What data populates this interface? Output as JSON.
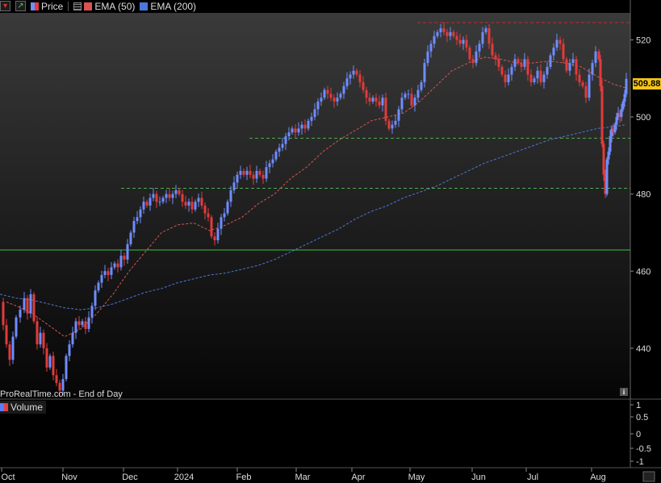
{
  "legend": {
    "price_label": "Price",
    "ema50_label": "EMA (50)",
    "ema200_label": "EMA (200)"
  },
  "colors": {
    "up": "#6f8dff",
    "down": "#e23b3b",
    "ema50": "#d9534f",
    "ema200": "#4a78d8",
    "support_line": "#3fbf3f",
    "resistance_line": "#c82828",
    "dashed_support": "#4caf50",
    "price_tag": "#f5c518"
  },
  "watermark": "ProRealTime.com - End of Day",
  "last_price_label": "509.88",
  "volume_panel": {
    "label": "Volume",
    "axis_ticks": [
      "1",
      "0.5",
      "0",
      "-0.5",
      "-1"
    ]
  },
  "chart_data": {
    "type": "candlestick",
    "y_ticks": [
      440,
      460,
      480,
      500,
      520
    ],
    "ylim": [
      427,
      527
    ],
    "x_labels": [
      "Oct",
      "Nov",
      "Dec",
      "2024",
      "Feb",
      "Mar",
      "Apr",
      "May",
      "Jun",
      "Jul",
      "Aug"
    ],
    "last_price": 509.88,
    "horizontal_lines": [
      {
        "kind": "resistance",
        "value": 524.5,
        "style": "dashed"
      },
      {
        "kind": "support",
        "value": 494.5,
        "style": "dashed"
      },
      {
        "kind": "support",
        "value": 481.5,
        "style": "dashed"
      },
      {
        "kind": "support",
        "value": 465.5,
        "style": "solid"
      }
    ],
    "price_path": [
      [
        0,
        452
      ],
      [
        4,
        446
      ],
      [
        8,
        441
      ],
      [
        12,
        437
      ],
      [
        16,
        443
      ],
      [
        20,
        448
      ],
      [
        25,
        450
      ],
      [
        30,
        453
      ],
      [
        34,
        449
      ],
      [
        38,
        454
      ],
      [
        42,
        447
      ],
      [
        46,
        441
      ],
      [
        50,
        444
      ],
      [
        54,
        440
      ],
      [
        58,
        435
      ],
      [
        62,
        438
      ],
      [
        66,
        433
      ],
      [
        70,
        431
      ],
      [
        74,
        429
      ],
      [
        78,
        432
      ],
      [
        82,
        438
      ],
      [
        86,
        441
      ],
      [
        90,
        444
      ],
      [
        94,
        447
      ],
      [
        98,
        446
      ],
      [
        102,
        447
      ],
      [
        106,
        445
      ],
      [
        110,
        448
      ],
      [
        114,
        451
      ],
      [
        118,
        455
      ],
      [
        122,
        457
      ],
      [
        126,
        459
      ],
      [
        130,
        460
      ],
      [
        134,
        459
      ],
      [
        138,
        461
      ],
      [
        142,
        462
      ],
      [
        146,
        461
      ],
      [
        150,
        464
      ],
      [
        154,
        463
      ],
      [
        158,
        467
      ],
      [
        162,
        470
      ],
      [
        166,
        473
      ],
      [
        170,
        474
      ],
      [
        174,
        476
      ],
      [
        178,
        478
      ],
      [
        182,
        477
      ],
      [
        186,
        479
      ],
      [
        190,
        480
      ],
      [
        194,
        478
      ],
      [
        198,
        478
      ],
      [
        202,
        479
      ],
      [
        206,
        480
      ],
      [
        210,
        479
      ],
      [
        214,
        480
      ],
      [
        218,
        481
      ],
      [
        222,
        480
      ],
      [
        226,
        478
      ],
      [
        230,
        477
      ],
      [
        234,
        478
      ],
      [
        238,
        476
      ],
      [
        242,
        478
      ],
      [
        246,
        479
      ],
      [
        250,
        477
      ],
      [
        254,
        475
      ],
      [
        258,
        474
      ],
      [
        262,
        469
      ],
      [
        266,
        468
      ],
      [
        270,
        471
      ],
      [
        274,
        474
      ],
      [
        278,
        475
      ],
      [
        282,
        478
      ],
      [
        286,
        481
      ],
      [
        290,
        483
      ],
      [
        294,
        485
      ],
      [
        298,
        486
      ],
      [
        302,
        485
      ],
      [
        306,
        486
      ],
      [
        310,
        485
      ],
      [
        314,
        484
      ],
      [
        318,
        486
      ],
      [
        322,
        485
      ],
      [
        326,
        484
      ],
      [
        330,
        487
      ],
      [
        334,
        488
      ],
      [
        338,
        489
      ],
      [
        342,
        491
      ],
      [
        346,
        492
      ],
      [
        350,
        493
      ],
      [
        354,
        495
      ],
      [
        358,
        496
      ],
      [
        362,
        497
      ],
      [
        366,
        496
      ],
      [
        370,
        497
      ],
      [
        374,
        498
      ],
      [
        378,
        497
      ],
      [
        382,
        499
      ],
      [
        386,
        500
      ],
      [
        390,
        502
      ],
      [
        394,
        504
      ],
      [
        398,
        505
      ],
      [
        402,
        507
      ],
      [
        406,
        506
      ],
      [
        410,
        505
      ],
      [
        414,
        504
      ],
      [
        418,
        505
      ],
      [
        422,
        506
      ],
      [
        426,
        508
      ],
      [
        430,
        510
      ],
      [
        434,
        511
      ],
      [
        438,
        512
      ],
      [
        442,
        511
      ],
      [
        446,
        509
      ],
      [
        450,
        507
      ],
      [
        454,
        505
      ],
      [
        458,
        504
      ],
      [
        462,
        505
      ],
      [
        466,
        504
      ],
      [
        470,
        503
      ],
      [
        474,
        505
      ],
      [
        478,
        499
      ],
      [
        482,
        497
      ],
      [
        486,
        498
      ],
      [
        490,
        499
      ],
      [
        494,
        502
      ],
      [
        498,
        505
      ],
      [
        502,
        506
      ],
      [
        506,
        506
      ],
      [
        510,
        503
      ],
      [
        514,
        505
      ],
      [
        518,
        507
      ],
      [
        522,
        509
      ],
      [
        526,
        514
      ],
      [
        530,
        517
      ],
      [
        534,
        519
      ],
      [
        538,
        521
      ],
      [
        542,
        522
      ],
      [
        546,
        523
      ],
      [
        550,
        522
      ],
      [
        554,
        521
      ],
      [
        558,
        522
      ],
      [
        562,
        521
      ],
      [
        566,
        520
      ],
      [
        570,
        519
      ],
      [
        574,
        520
      ],
      [
        578,
        518
      ],
      [
        582,
        515
      ],
      [
        586,
        514
      ],
      [
        590,
        517
      ],
      [
        594,
        519
      ],
      [
        598,
        522
      ],
      [
        602,
        523
      ],
      [
        606,
        519
      ],
      [
        610,
        516
      ],
      [
        614,
        515
      ],
      [
        618,
        513
      ],
      [
        622,
        511
      ],
      [
        626,
        509
      ],
      [
        630,
        511
      ],
      [
        634,
        513
      ],
      [
        638,
        515
      ],
      [
        642,
        514
      ],
      [
        646,
        513
      ],
      [
        650,
        515
      ],
      [
        654,
        511
      ],
      [
        658,
        509
      ],
      [
        662,
        510
      ],
      [
        666,
        512
      ],
      [
        670,
        509
      ],
      [
        674,
        511
      ],
      [
        678,
        513
      ],
      [
        682,
        516
      ],
      [
        686,
        518
      ],
      [
        690,
        520
      ],
      [
        694,
        519
      ],
      [
        698,
        515
      ],
      [
        702,
        512
      ],
      [
        706,
        514
      ],
      [
        710,
        515
      ],
      [
        714,
        511
      ],
      [
        718,
        509
      ],
      [
        722,
        508
      ],
      [
        726,
        505
      ],
      [
        730,
        511
      ],
      [
        734,
        514
      ],
      [
        738,
        517
      ],
      [
        742,
        515
      ],
      [
        744,
        508
      ],
      [
        746,
        493
      ],
      [
        748,
        485
      ],
      [
        750,
        480
      ],
      [
        752,
        489
      ],
      [
        754,
        491
      ],
      [
        756,
        495
      ],
      [
        758,
        497
      ],
      [
        760,
        496
      ],
      [
        762,
        498
      ],
      [
        764,
        500
      ],
      [
        766,
        501
      ],
      [
        768,
        500
      ],
      [
        770,
        502
      ],
      [
        772,
        504
      ],
      [
        774,
        506
      ],
      [
        776,
        509.88
      ]
    ],
    "ema50_path": [
      [
        8,
        452
      ],
      [
        20,
        451
      ],
      [
        40,
        449
      ],
      [
        60,
        446
      ],
      [
        80,
        443
      ],
      [
        100,
        445
      ],
      [
        120,
        449
      ],
      [
        140,
        454
      ],
      [
        160,
        460
      ],
      [
        180,
        465
      ],
      [
        200,
        470
      ],
      [
        220,
        472
      ],
      [
        240,
        472.5
      ],
      [
        260,
        470.5
      ],
      [
        280,
        472
      ],
      [
        300,
        474
      ],
      [
        320,
        477.5
      ],
      [
        340,
        480
      ],
      [
        360,
        484
      ],
      [
        380,
        487
      ],
      [
        400,
        491
      ],
      [
        420,
        494
      ],
      [
        440,
        496.5
      ],
      [
        460,
        499
      ],
      [
        480,
        500
      ],
      [
        500,
        501
      ],
      [
        520,
        504
      ],
      [
        540,
        508
      ],
      [
        560,
        512
      ],
      [
        580,
        514
      ],
      [
        600,
        515.5
      ],
      [
        620,
        515
      ],
      [
        640,
        514
      ],
      [
        660,
        514
      ],
      [
        680,
        514.5
      ],
      [
        700,
        514
      ],
      [
        720,
        513
      ],
      [
        740,
        510.5
      ],
      [
        760,
        508.5
      ],
      [
        776,
        507.5
      ]
    ],
    "ema200_path": [
      [
        0,
        454
      ],
      [
        20,
        453
      ],
      [
        40,
        452.5
      ],
      [
        60,
        451.5
      ],
      [
        80,
        450.5
      ],
      [
        100,
        450
      ],
      [
        120,
        450.5
      ],
      [
        140,
        451.5
      ],
      [
        160,
        453
      ],
      [
        180,
        454.5
      ],
      [
        200,
        455.5
      ],
      [
        220,
        457
      ],
      [
        240,
        458
      ],
      [
        260,
        459
      ],
      [
        280,
        459.5
      ],
      [
        300,
        460.5
      ],
      [
        320,
        461.5
      ],
      [
        340,
        463
      ],
      [
        360,
        465
      ],
      [
        380,
        467
      ],
      [
        400,
        469
      ],
      [
        420,
        471
      ],
      [
        440,
        473.5
      ],
      [
        460,
        475.5
      ],
      [
        480,
        477
      ],
      [
        500,
        479
      ],
      [
        520,
        480.5
      ],
      [
        540,
        482
      ],
      [
        560,
        484
      ],
      [
        580,
        486
      ],
      [
        600,
        488
      ],
      [
        620,
        489.5
      ],
      [
        640,
        491
      ],
      [
        660,
        492.5
      ],
      [
        680,
        494
      ],
      [
        700,
        495
      ],
      [
        720,
        496
      ],
      [
        740,
        497
      ],
      [
        760,
        497.5
      ],
      [
        776,
        498
      ]
    ]
  }
}
